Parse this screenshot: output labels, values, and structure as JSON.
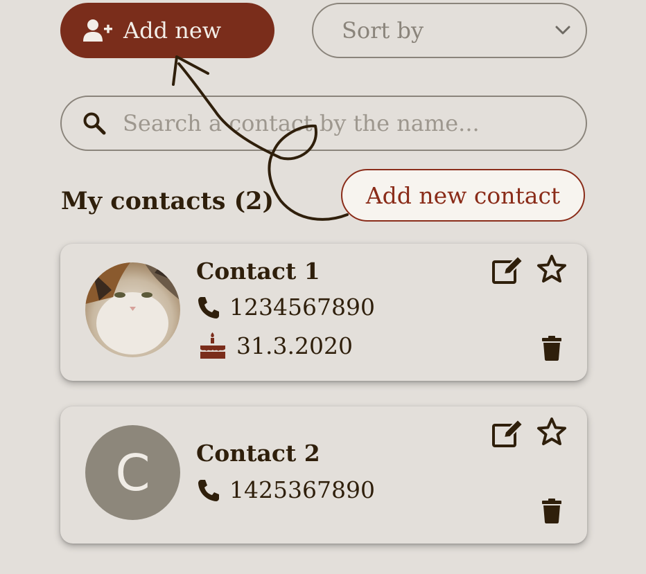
{
  "toolbar": {
    "add_label": "Add new",
    "sort_label": "Sort by"
  },
  "search": {
    "placeholder": "Search a contact by the name..."
  },
  "contacts_title": "My contacts (2)",
  "tooltip": "Add new contact",
  "contacts": [
    {
      "name": "Contact 1",
      "phone": "1234567890",
      "birthday": "31.3.2020",
      "avatar": "cat-photo"
    },
    {
      "name": "Contact 2",
      "phone": "1425367890",
      "avatar_letter": "C"
    }
  ],
  "colors": {
    "background": "#e3dfda",
    "accent": "#7a2d1b",
    "text": "#2f1f0b",
    "muted": "#8a847b",
    "avatar_placeholder": "#8d877b"
  }
}
